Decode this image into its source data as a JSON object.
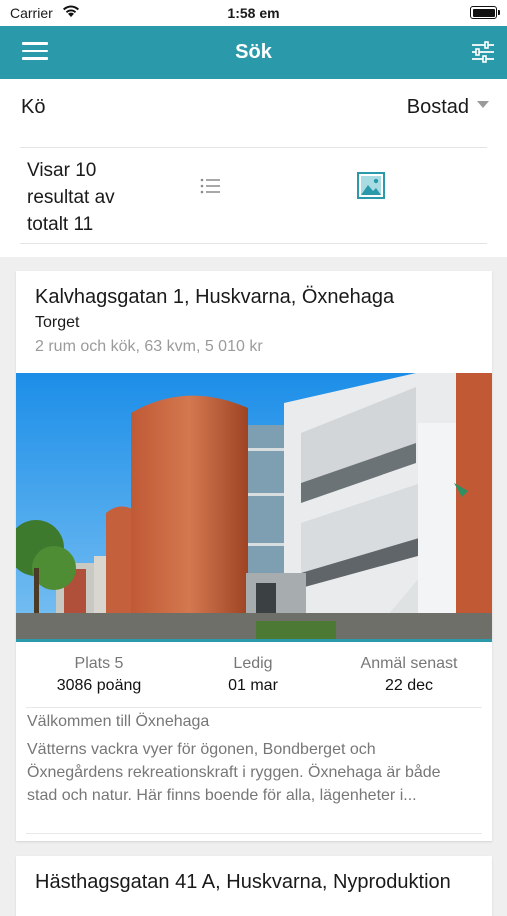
{
  "status_bar": {
    "carrier": "Carrier",
    "time": "1:58 em"
  },
  "nav": {
    "title": "Sök"
  },
  "queue": {
    "label": "Kö",
    "selected_type": "Bostad"
  },
  "results": {
    "text": "Visar 10 resultat av totalt 11"
  },
  "listings": [
    {
      "address": "Kalvhagsgatan 1, Huskvarna, Öxnehaga",
      "area": "Torget",
      "details": "2 rum och kök, 63 kvm, 5 010 kr",
      "stats": [
        {
          "label": "Plats 5",
          "value": "3086 poäng"
        },
        {
          "label": "Ledig",
          "value": "01 mar"
        },
        {
          "label": "Anmäl senast",
          "value": "22 dec"
        }
      ],
      "headline": "Välkommen till Öxnehaga",
      "description": "Vätterns vackra vyer för ögonen, Bondberget och Öxnegårdens rekreationskraft i ryggen. Öxnehaga är både stad och natur. Här finns boende för alla, lägenheter i..."
    },
    {
      "address": "Hästhagsgatan 41 A, Huskvarna, Nyproduktion"
    }
  ],
  "colors": {
    "brand": "#2a9aaa",
    "muted_text": "#777777"
  },
  "icons": {
    "menu": "hamburger-menu-icon",
    "filter": "sliders-icon",
    "list_view": "list-icon",
    "image_view": "image-icon",
    "dropdown": "caret-down-icon"
  }
}
